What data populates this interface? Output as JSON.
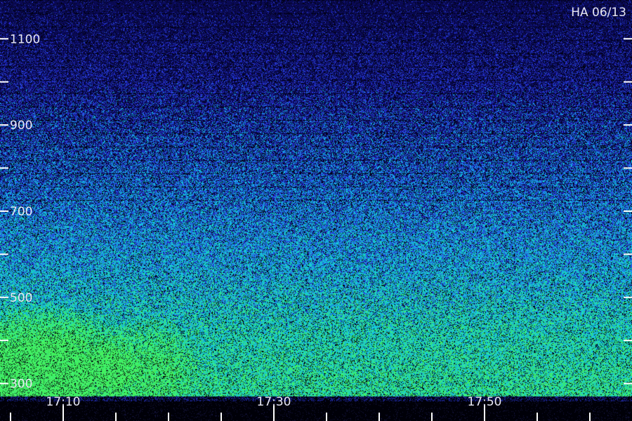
{
  "chart_data": {
    "type": "heatmap",
    "title": "HA 06/13",
    "xlabel": "",
    "ylabel": "",
    "x": {
      "range": [
        "17:04",
        "18:04"
      ],
      "tick_labels": [
        "17:10",
        "17:30",
        "17:50"
      ],
      "tick_values_min": [
        6,
        26,
        46
      ],
      "minor_tick_every_min": 5
    },
    "y": {
      "range": [
        270,
        1190
      ],
      "tick_labels": [
        "1100",
        "900",
        "700",
        "500",
        "300"
      ],
      "tick_values": [
        1100,
        900,
        700,
        500,
        300
      ],
      "minor_ticks": [
        1000,
        800,
        600,
        400
      ]
    },
    "intensity": {
      "description_levels": "stronger at low altitude, weaker at high altitude",
      "colors": {
        "low": "#0a0a40",
        "mid_low": "#2a3ad8",
        "mid": "#1ab8e0",
        "high": "#30e860",
        "noise_floor": "#000010"
      }
    }
  }
}
